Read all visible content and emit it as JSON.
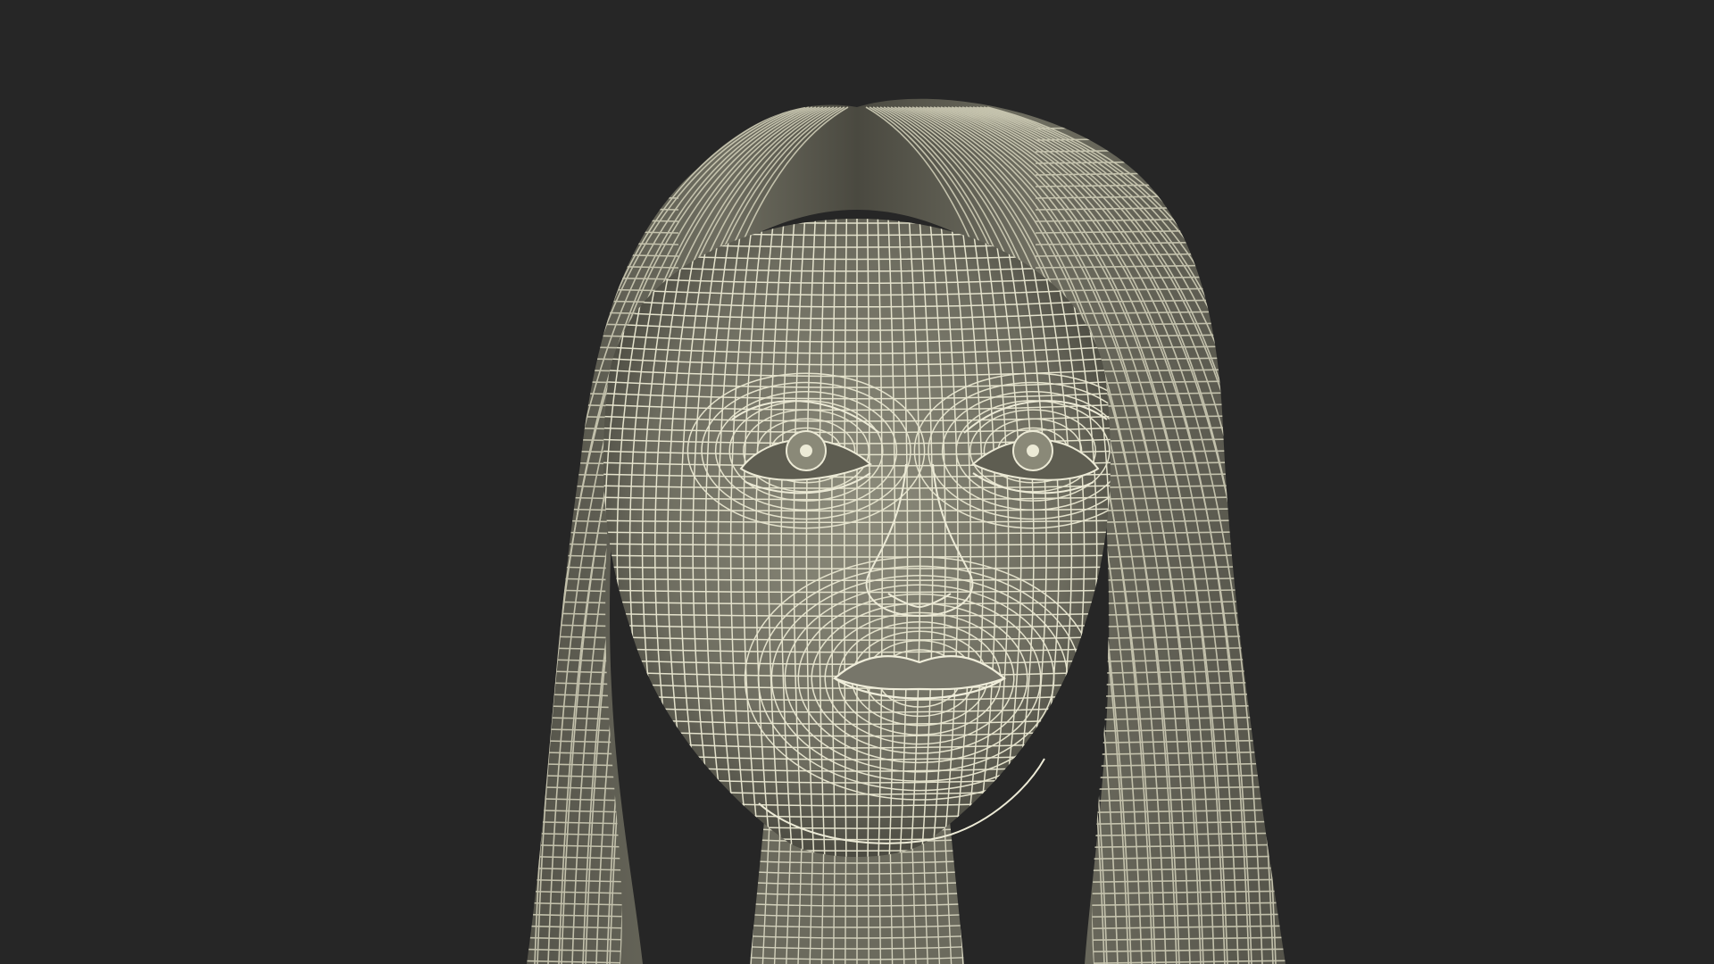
{
  "scene": {
    "subject": "wireframe-female-head",
    "background_color": "#262626",
    "surface_color": "#7c7b6c",
    "surface_shadow_color": "#4d4c42",
    "wire_color": "#e4e2cc",
    "hair_wire_color": "#cfcdb6"
  }
}
